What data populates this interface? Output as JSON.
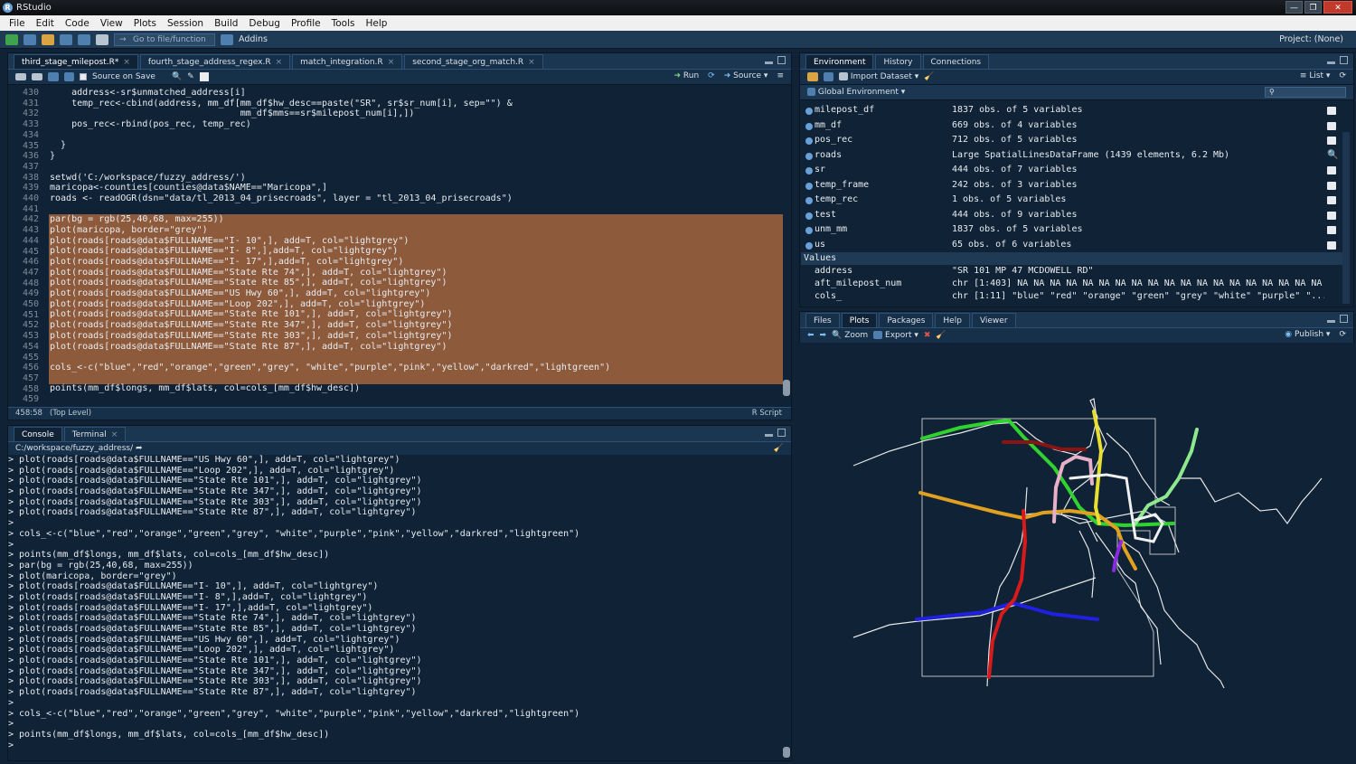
{
  "window": {
    "title": "RStudio",
    "minimize": "—",
    "maximize": "❐",
    "close": "✕"
  },
  "menu": [
    "File",
    "Edit",
    "Code",
    "View",
    "Plots",
    "Session",
    "Build",
    "Debug",
    "Profile",
    "Tools",
    "Help"
  ],
  "toolbar": {
    "goto_placeholder": "Go to file/function",
    "addins": "Addins",
    "project": "Project: (None)"
  },
  "editor": {
    "tabs": [
      {
        "label": "third_stage_milepost.R*",
        "active": true
      },
      {
        "label": "fourth_stage_address_regex.R",
        "active": false
      },
      {
        "label": "match_integration.R",
        "active": false
      },
      {
        "label": "second_stage_org_match.R",
        "active": false
      }
    ],
    "source_on_save": "Source on Save",
    "run": "Run",
    "source": "Source",
    "line_numbers": [
      "430",
      "431",
      "432",
      "433",
      "434",
      "435",
      "436",
      "437",
      "438",
      "439",
      "440",
      "441",
      "442",
      "443",
      "444",
      "445",
      "446",
      "447",
      "448",
      "449",
      "450",
      "451",
      "452",
      "453",
      "454",
      "455",
      "456",
      "457",
      "458",
      "459"
    ],
    "lines": [
      "    address<-sr$unmatched_address[i]",
      "    temp_rec<-cbind(address, mm_df[mm_df$hw_desc==paste(\"SR\", sr$sr_num[i], sep=\"\") &",
      "                                   mm_df$mms==sr$milepost_num[i],])",
      "    pos_rec<-rbind(pos_rec, temp_rec)",
      "",
      "  }",
      "}",
      "",
      "setwd('C:/workspace/fuzzy_address/')",
      "maricopa<-counties[counties@data$NAME==\"Maricopa\",]",
      "roads <- readOGR(dsn=\"data/tl_2013_04_prisecroads\", layer = \"tl_2013_04_prisecroads\")",
      "",
      "par(bg = rgb(25,40,68, max=255))",
      "plot(maricopa, border=\"grey\")",
      "plot(roads[roads@data$FULLNAME==\"I- 10\",], add=T, col=\"lightgrey\")",
      "plot(roads[roads@data$FULLNAME==\"I- 8\",],add=T, col=\"lightgrey\")",
      "plot(roads[roads@data$FULLNAME==\"I- 17\",],add=T, col=\"lightgrey\")",
      "plot(roads[roads@data$FULLNAME==\"State Rte 74\",], add=T, col=\"lightgrey\")",
      "plot(roads[roads@data$FULLNAME==\"State Rte 85\",], add=T, col=\"lightgrey\")",
      "plot(roads[roads@data$FULLNAME==\"US Hwy 60\",], add=T, col=\"lightgrey\")",
      "plot(roads[roads@data$FULLNAME==\"Loop 202\",], add=T, col=\"lightgrey\")",
      "plot(roads[roads@data$FULLNAME==\"State Rte 101\",], add=T, col=\"lightgrey\")",
      "plot(roads[roads@data$FULLNAME==\"State Rte 347\",], add=T, col=\"lightgrey\")",
      "plot(roads[roads@data$FULLNAME==\"State Rte 303\",], add=T, col=\"lightgrey\")",
      "plot(roads[roads@data$FULLNAME==\"State Rte 87\",], add=T, col=\"lightgrey\")",
      "",
      "cols_<-c(\"blue\",\"red\",\"orange\",\"green\",\"grey\", \"white\",\"purple\",\"pink\",\"yellow\",\"darkred\",\"lightgreen\")",
      "",
      "points(mm_df$longs, mm_df$lats, col=cols_[mm_df$hw_desc])",
      ""
    ],
    "status_position": "458:58",
    "status_scope": "(Top Level)",
    "status_type": "R Script"
  },
  "console": {
    "tabs": [
      "Console",
      "Terminal"
    ],
    "path": "C:/workspace/fuzzy_address/",
    "lines": [
      "> plot(roads[roads@data$FULLNAME==\"US Hwy 60\",], add=T, col=\"lightgrey\")",
      "> plot(roads[roads@data$FULLNAME==\"Loop 202\",], add=T, col=\"lightgrey\")",
      "> plot(roads[roads@data$FULLNAME==\"State Rte 101\",], add=T, col=\"lightgrey\")",
      "> plot(roads[roads@data$FULLNAME==\"State Rte 347\",], add=T, col=\"lightgrey\")",
      "> plot(roads[roads@data$FULLNAME==\"State Rte 303\",], add=T, col=\"lightgrey\")",
      "> plot(roads[roads@data$FULLNAME==\"State Rte 87\",], add=T, col=\"lightgrey\")",
      ">",
      "> cols_<-c(\"blue\",\"red\",\"orange\",\"green\",\"grey\", \"white\",\"purple\",\"pink\",\"yellow\",\"darkred\",\"lightgreen\")",
      ">",
      "> points(mm_df$longs, mm_df$lats, col=cols_[mm_df$hw_desc])",
      "> par(bg = rgb(25,40,68, max=255))",
      "> plot(maricopa, border=\"grey\")",
      "> plot(roads[roads@data$FULLNAME==\"I- 10\",], add=T, col=\"lightgrey\")",
      "> plot(roads[roads@data$FULLNAME==\"I- 8\",],add=T, col=\"lightgrey\")",
      "> plot(roads[roads@data$FULLNAME==\"I- 17\",],add=T, col=\"lightgrey\")",
      "> plot(roads[roads@data$FULLNAME==\"State Rte 74\",], add=T, col=\"lightgrey\")",
      "> plot(roads[roads@data$FULLNAME==\"State Rte 85\",], add=T, col=\"lightgrey\")",
      "> plot(roads[roads@data$FULLNAME==\"US Hwy 60\",], add=T, col=\"lightgrey\")",
      "> plot(roads[roads@data$FULLNAME==\"Loop 202\",], add=T, col=\"lightgrey\")",
      "> plot(roads[roads@data$FULLNAME==\"State Rte 101\",], add=T, col=\"lightgrey\")",
      "> plot(roads[roads@data$FULLNAME==\"State Rte 347\",], add=T, col=\"lightgrey\")",
      "> plot(roads[roads@data$FULLNAME==\"State Rte 303\",], add=T, col=\"lightgrey\")",
      "> plot(roads[roads@data$FULLNAME==\"State Rte 87\",], add=T, col=\"lightgrey\")",
      ">",
      "> cols_<-c(\"blue\",\"red\",\"orange\",\"green\",\"grey\", \"white\",\"purple\",\"pink\",\"yellow\",\"darkred\",\"lightgreen\")",
      ">",
      "> points(mm_df$longs, mm_df$lats, col=cols_[mm_df$hw_desc])",
      ">"
    ]
  },
  "environment": {
    "tabs": [
      "Environment",
      "History",
      "Connections"
    ],
    "import_dataset": "Import Dataset",
    "view_mode": "List",
    "scope": "Global Environment",
    "data": [
      {
        "name": "milepost_df",
        "value": "1837 obs. of 5 variables",
        "icon": "grid"
      },
      {
        "name": "mm_df",
        "value": "669 obs. of 4 variables",
        "icon": "grid"
      },
      {
        "name": "pos_rec",
        "value": "712 obs. of 5 variables",
        "icon": "grid"
      },
      {
        "name": "roads",
        "value": "Large SpatialLinesDataFrame (1439 elements, 6.2 Mb)",
        "icon": "search"
      },
      {
        "name": "sr",
        "value": "444 obs. of 7 variables",
        "icon": "grid"
      },
      {
        "name": "temp_frame",
        "value": "242 obs. of 3 variables",
        "icon": "grid"
      },
      {
        "name": "temp_rec",
        "value": "1 obs. of 5 variables",
        "icon": "grid"
      },
      {
        "name": "test",
        "value": "444 obs. of 9 variables",
        "icon": "grid"
      },
      {
        "name": "unm_mm",
        "value": "1837 obs. of 5 variables",
        "icon": "grid"
      },
      {
        "name": "us",
        "value": "65 obs. of 6 variables",
        "icon": "grid"
      }
    ],
    "values_header": "Values",
    "values": [
      {
        "name": "address",
        "value": "\"SR 101 MP 47 MCDOWELL RD\""
      },
      {
        "name": "aft_milepost_num",
        "value": "chr [1:403] NA NA NA NA NA NA NA NA NA NA NA NA NA NA NA NA NA NA NA NA ..."
      },
      {
        "name": "cols_",
        "value": "chr [1:11] \"blue\" \"red\" \"orange\" \"green\" \"grey\" \"white\" \"purple\" \"..."
      }
    ]
  },
  "files": {
    "tabs": [
      "Files",
      "Plots",
      "Packages",
      "Help",
      "Viewer"
    ],
    "active_tab": "Plots",
    "zoom": "Zoom",
    "export": "Export",
    "publish": "Publish"
  },
  "plot_colors": {
    "background": "#0f2236",
    "roads": "#e6e6e6",
    "border": "#bebebe"
  }
}
